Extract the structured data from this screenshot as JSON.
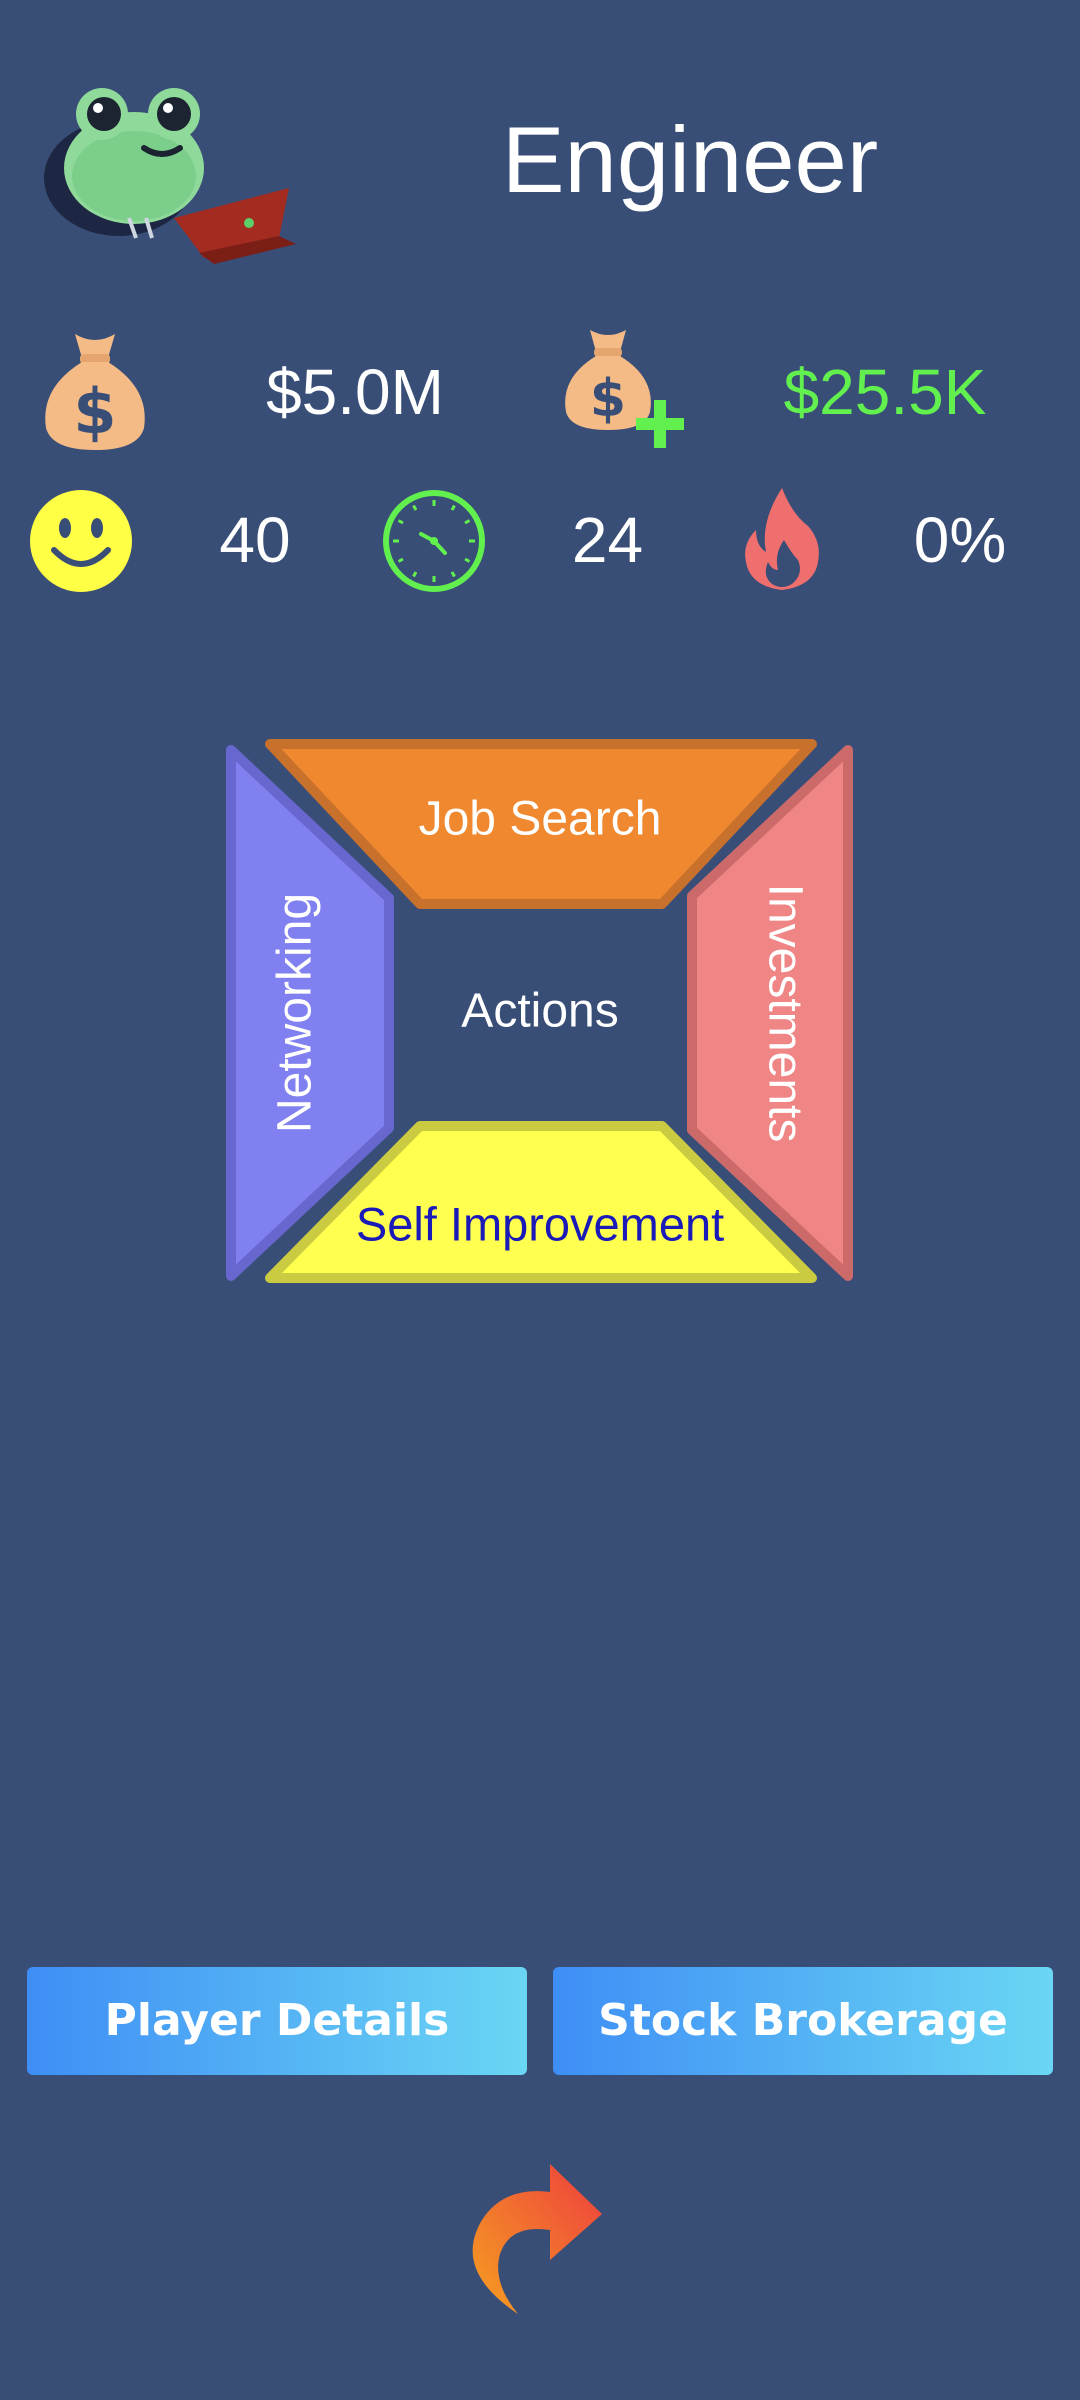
{
  "header": {
    "title": "Engineer",
    "avatar_icon": "frog-with-laptop-icon"
  },
  "stats": {
    "money": {
      "icon": "money-bag-icon",
      "value": "$5.0M"
    },
    "income": {
      "icon": "money-bag-plus-icon",
      "value": "$25.5K",
      "color": "#62f04e"
    },
    "happiness": {
      "icon": "smiley-icon",
      "value": "40"
    },
    "time": {
      "icon": "clock-icon",
      "value": "24"
    },
    "burnout": {
      "icon": "fire-icon",
      "value": "0%"
    }
  },
  "actions": {
    "center_label": "Actions",
    "top": {
      "label": "Job Search",
      "color": "#f0882f"
    },
    "left": {
      "label": "Networking",
      "color": "#8080f0"
    },
    "right": {
      "label": "Investments",
      "color": "#ef8585"
    },
    "bottom": {
      "label": "Self Improvement",
      "color": "#ffff50",
      "text_color": "#1a1ab8"
    }
  },
  "buttons": {
    "player_details": "Player Details",
    "stock_brokerage": "Stock Brokerage",
    "next_icon": "curved-arrow-icon"
  }
}
